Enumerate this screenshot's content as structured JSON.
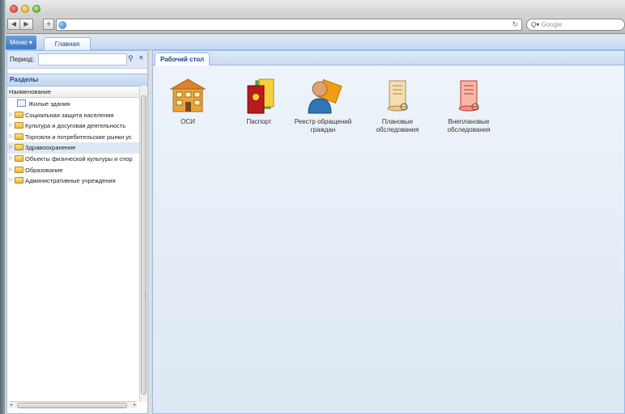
{
  "browser": {
    "search_placeholder": "Google"
  },
  "app": {
    "menu_label": "Меню ▾",
    "main_tab": "Главная"
  },
  "left": {
    "period_label": "Период:",
    "sections_title": "Разделы",
    "column_header": "Наименование",
    "items": [
      {
        "label": "Жилые здания",
        "type": "doc"
      },
      {
        "label": "Социальная защита населения",
        "type": "folder"
      },
      {
        "label": "Культура и досуговая деятельность",
        "type": "folder"
      },
      {
        "label": "Торговля и потребительские рынки ус",
        "type": "folder"
      },
      {
        "label": "Здравоохранение",
        "type": "folder",
        "selected": true
      },
      {
        "label": "Объекты физической культуры и спор",
        "type": "folder"
      },
      {
        "label": "Образование",
        "type": "folder"
      },
      {
        "label": "Административные учреждения",
        "type": "folder"
      }
    ]
  },
  "desktop": {
    "tab_label": "Рабочий стол",
    "tiles": [
      {
        "label": "ОСИ",
        "icon": "building-icon"
      },
      {
        "label": "Паспорт",
        "icon": "passport-books-icon"
      },
      {
        "label": "Реестр обращений граждан",
        "icon": "user-register-icon"
      },
      {
        "label": "Плановые обследования",
        "icon": "scroll-certificate-icon"
      },
      {
        "label": "Внеплановые обследования",
        "icon": "red-scroll-certificate-icon"
      }
    ]
  }
}
